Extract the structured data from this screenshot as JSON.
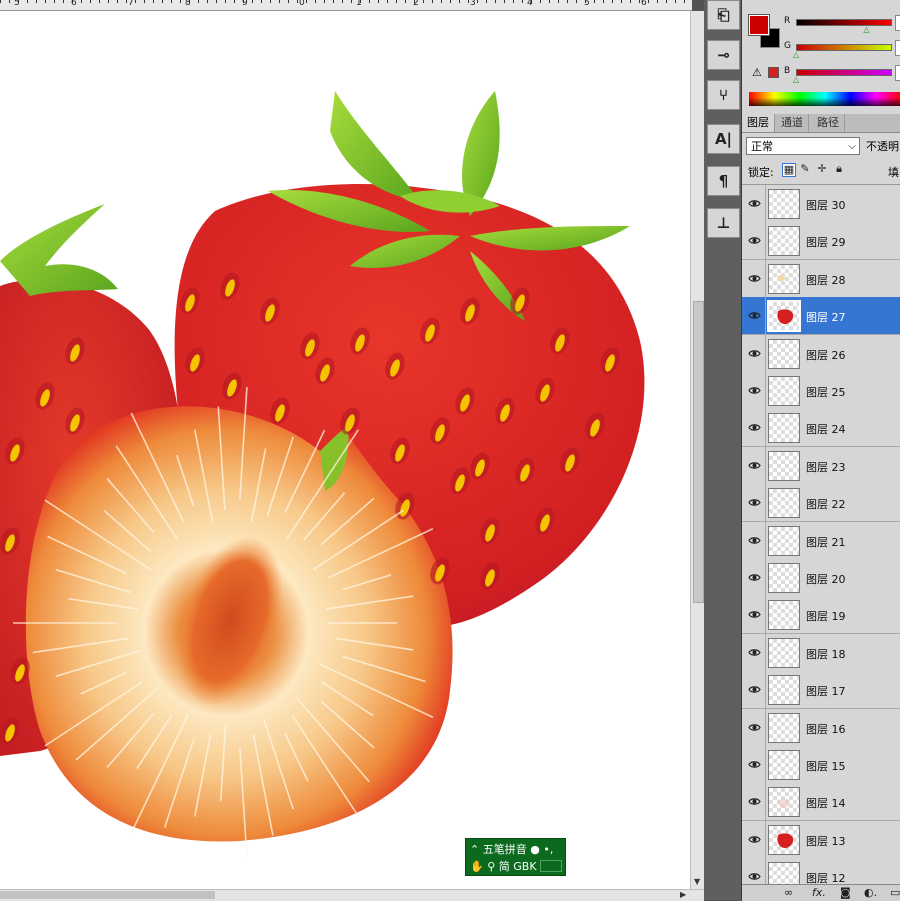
{
  "ruler": {
    "numbers": [
      "5",
      "6",
      "7",
      "8",
      "9",
      "0",
      "1",
      "2",
      "3",
      "4",
      "5",
      "6"
    ]
  },
  "colors": {
    "foreground": "#cc0000",
    "background": "#000000",
    "selection": "#3576d3",
    "strawberry_red": "#d42020",
    "seed_yellow": "#f5c400",
    "leaf_green": "#7fc62b"
  },
  "color_panel": {
    "channels": [
      {
        "label": "R",
        "level": 0.77
      },
      {
        "label": "G",
        "level": 0.02
      },
      {
        "label": "B",
        "level": 0.02
      }
    ]
  },
  "tabs": [
    "图层",
    "通道",
    "路径"
  ],
  "blend_mode": "正常",
  "opacity_label": "不透明",
  "lock_label": "锁定:",
  "fill_label": "填",
  "layers": [
    {
      "name": "图层 30",
      "visible": true,
      "selected": false,
      "thumb": "empty"
    },
    {
      "name": "图层 29",
      "visible": true,
      "selected": false,
      "thumb": "empty"
    },
    {
      "name": "图层 28",
      "visible": true,
      "selected": false,
      "thumb": "blob-light"
    },
    {
      "name": "图层 27",
      "visible": true,
      "selected": true,
      "thumb": "strawberry"
    },
    {
      "name": "图层 26",
      "visible": true,
      "selected": false,
      "thumb": "empty"
    },
    {
      "name": "图层 25",
      "visible": true,
      "selected": false,
      "thumb": "empty"
    },
    {
      "name": "图层 24",
      "visible": true,
      "selected": false,
      "thumb": "empty"
    },
    {
      "name": "图层 23",
      "visible": true,
      "selected": false,
      "thumb": "empty"
    },
    {
      "name": "图层 22",
      "visible": true,
      "selected": false,
      "thumb": "empty"
    },
    {
      "name": "图层 21",
      "visible": true,
      "selected": false,
      "thumb": "empty"
    },
    {
      "name": "图层 20",
      "visible": true,
      "selected": false,
      "thumb": "empty"
    },
    {
      "name": "图层 19",
      "visible": true,
      "selected": false,
      "thumb": "empty"
    },
    {
      "name": "图层 18",
      "visible": true,
      "selected": false,
      "thumb": "empty"
    },
    {
      "name": "图层 17",
      "visible": true,
      "selected": false,
      "thumb": "empty"
    },
    {
      "name": "图层 16",
      "visible": true,
      "selected": false,
      "thumb": "empty"
    },
    {
      "name": "图层 15",
      "visible": true,
      "selected": false,
      "thumb": "empty"
    },
    {
      "name": "图层 14",
      "visible": true,
      "selected": false,
      "thumb": "pink"
    },
    {
      "name": "图层 13",
      "visible": true,
      "selected": false,
      "thumb": "strawberry"
    },
    {
      "name": "图层 12",
      "visible": true,
      "selected": false,
      "thumb": "empty"
    }
  ],
  "dock_icons": [
    "history-icon",
    "adjust-icon",
    "usb-icon",
    "character-icon",
    "paragraph-icon",
    "stamp-icon"
  ],
  "ime": {
    "mode": "五笔拼音",
    "lang": "简",
    "encoding": "GBK"
  },
  "bottom_icons": [
    "link-icon",
    "fx-icon",
    "mask-icon",
    "adjustment-icon",
    "folder-icon"
  ]
}
